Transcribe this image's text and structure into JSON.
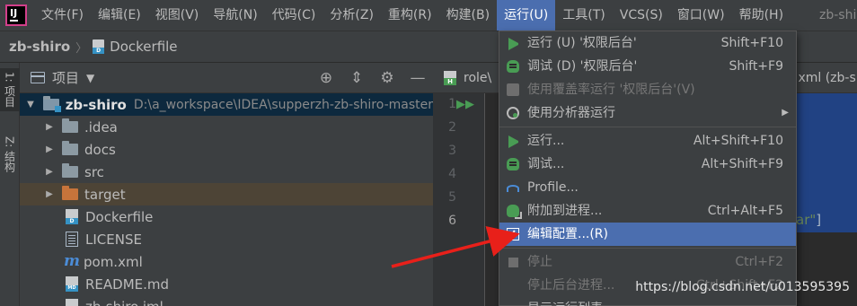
{
  "menubar": {
    "items": [
      "文件(F)",
      "编辑(E)",
      "视图(V)",
      "导航(N)",
      "代码(C)",
      "分析(Z)",
      "重构(R)",
      "构建(B)",
      "运行(U)",
      "工具(T)",
      "VCS(S)",
      "窗口(W)",
      "帮助(H)"
    ],
    "active_index": 8,
    "window_title": "zb-shiro"
  },
  "navbar": {
    "project": "zb-shiro",
    "file": "Dockerfile"
  },
  "tool_strip": {
    "project_tab": "1: 项目",
    "structure_tab": "Z: 结构"
  },
  "project_panel": {
    "title": "项目",
    "tree": [
      {
        "name": "zb-shiro",
        "path": "D:\\a_workspace\\IDEA\\supperzh-zb-shiro-master"
      },
      {
        "name": ".idea"
      },
      {
        "name": "docs"
      },
      {
        "name": "src"
      },
      {
        "name": "target"
      },
      {
        "name": "Dockerfile"
      },
      {
        "name": "LICENSE"
      },
      {
        "name": "pom.xml"
      },
      {
        "name": "README.md"
      },
      {
        "name": "zb-shiro.iml"
      }
    ]
  },
  "editor": {
    "tab_label": "role\\",
    "tab2_label": ".xml (zb-s",
    "line_numbers": [
      "1",
      "2",
      "3",
      "4",
      "5",
      "6"
    ],
    "code_tail": "ar\"",
    "code_bracket": "]"
  },
  "run_menu": {
    "items": [
      {
        "label": "运行 (U) '权限后台'",
        "shortcut": "Shift+F10",
        "icon": "run-icon"
      },
      {
        "label": "调试 (D) '权限后台'",
        "shortcut": "Shift+F9",
        "icon": "debug-icon"
      },
      {
        "label": "使用覆盖率运行 '权限后台'(V)",
        "shortcut": "",
        "icon": "coverage-icon",
        "disabled": true
      },
      {
        "label": "使用分析器运行",
        "shortcut": "",
        "icon": "profiler-icon",
        "submenu": true
      },
      {
        "label": "运行...",
        "shortcut": "Alt+Shift+F10",
        "icon": "run-icon"
      },
      {
        "label": "调试...",
        "shortcut": "Alt+Shift+F9",
        "icon": "debug-icon"
      },
      {
        "label": "Profile...",
        "shortcut": "",
        "icon": "profile-gauge-icon"
      },
      {
        "label": "附加到进程...",
        "shortcut": "Ctrl+Alt+F5",
        "icon": "attach-icon"
      },
      {
        "label": "编辑配置...(R)",
        "shortcut": "",
        "icon": "edit-config-icon",
        "hover": true
      },
      {
        "label": "停止",
        "shortcut": "Ctrl+F2",
        "icon": "stop-icon",
        "disabled": true
      },
      {
        "label": "停止后台进程...",
        "shortcut": "Ctrl+Shift+F2",
        "icon": "",
        "disabled": true
      },
      {
        "label": "显示运行列表",
        "shortcut": "",
        "icon": "",
        "disabled": false
      }
    ]
  },
  "watermark": "https://blog.csdn.net/u013595395",
  "colors": {
    "accent": "#4b6eaf",
    "annotation_arrow": "#e8201a"
  }
}
